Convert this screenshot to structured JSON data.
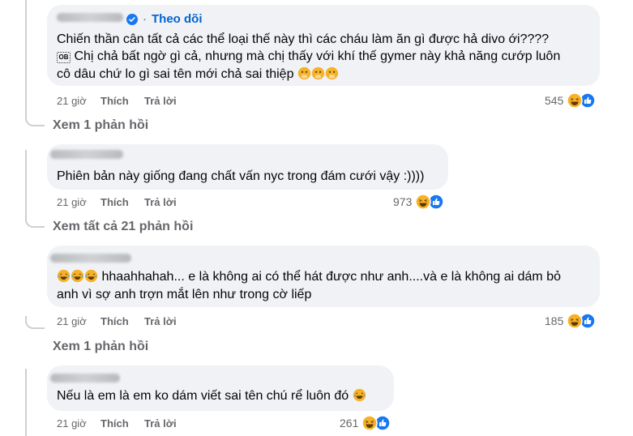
{
  "comments": [
    {
      "follow_label": "Theo dõi",
      "lines": [
        "Chiến thần cân tất cả các thể loại thế này thì các cháu làm ăn gì được hả divo ới????",
        "Chị chả bất ngờ gì cả, nhưng mà chị thấy với khí thế gymer này khả năng cướp luôn",
        "cô dâu chứ lo gì sai tên mới chả sai thiệp"
      ],
      "ob_icon_label": "OB",
      "time": "21 giờ",
      "like_label": "Thích",
      "reply_label": "Trả lời",
      "reaction_count": "545",
      "view_replies": "Xem 1 phản hồi"
    },
    {
      "lines": [
        "Phiên bản này giống đang chất vấn nyc trong đám cưới vậy :))))"
      ],
      "time": "21 giờ",
      "like_label": "Thích",
      "reply_label": "Trả lời",
      "reaction_count": "973",
      "view_replies": "Xem tất cả 21 phản hồi"
    },
    {
      "lines": [
        "hhaahhahah... e là không ai có thể hát được như anh....và e là không ai dám bỏ",
        "anh vì sợ anh trợn mắt lên như trong cờ liếp"
      ],
      "time": "21 giờ",
      "like_label": "Thích",
      "reply_label": "Trả lời",
      "reaction_count": "185",
      "view_replies": "Xem 1 phản hồi"
    },
    {
      "lines": [
        "Nếu là em là em ko dám viết sai tên chú rể luôn đó"
      ],
      "time": "21 giờ",
      "like_label": "Thích",
      "reply_label": "Trả lời",
      "reaction_count": "261"
    }
  ],
  "icons": {
    "verified": "verified-badge-icon",
    "haha": "haha-reaction-icon",
    "like": "like-reaction-icon",
    "hand_over_mouth": "hand-over-mouth-emoji",
    "laughing": "laughing-emoji"
  },
  "colors": {
    "bubble": "#f0f2f5",
    "link_blue": "#0064d1",
    "meta_gray": "#65676b",
    "like_blue": "#1877f2",
    "haha_yellow": "#f7b125"
  }
}
